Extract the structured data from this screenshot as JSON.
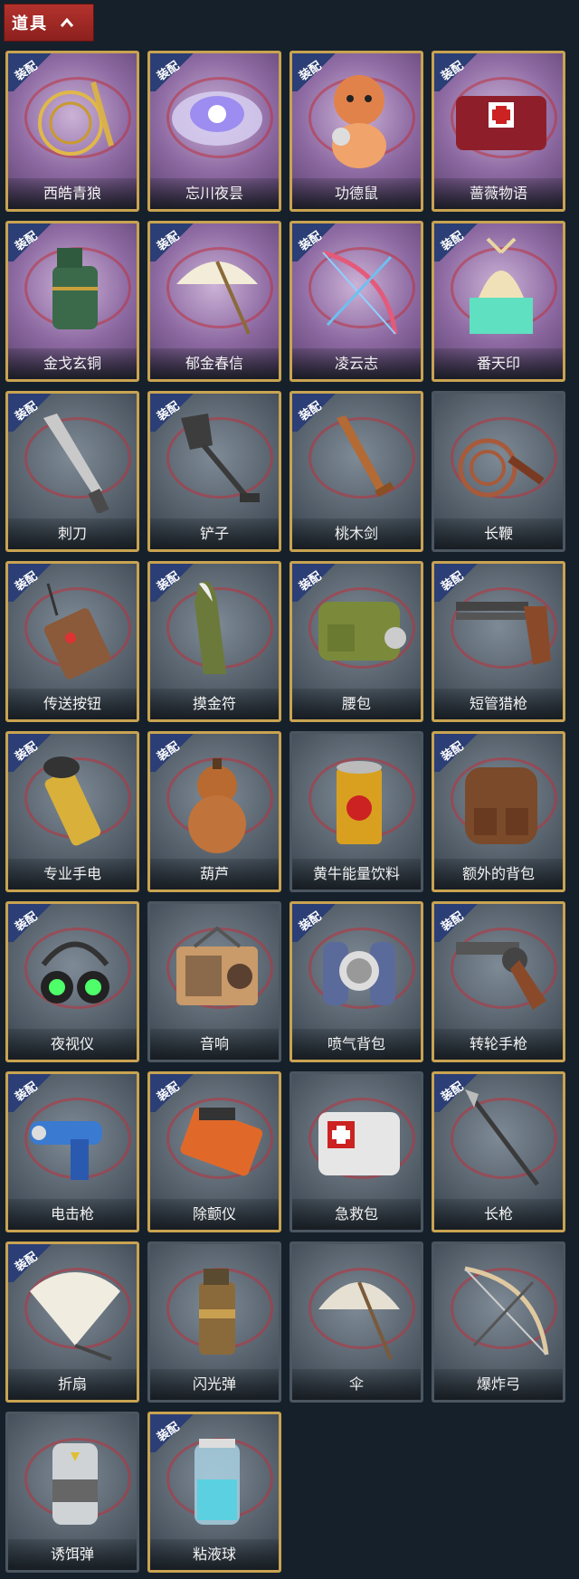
{
  "header": {
    "title": "道具",
    "toggle_icon": "chevron-up-icon"
  },
  "badge_text": "装配",
  "items": [
    {
      "label": "西皓青狼",
      "equipped": true,
      "theme": "purple",
      "icon": "golden-whip-icon"
    },
    {
      "label": "忘川夜昙",
      "equipped": true,
      "theme": "purple",
      "icon": "lotus-icon"
    },
    {
      "label": "功德鼠",
      "equipped": true,
      "theme": "purple",
      "icon": "hamster-icon"
    },
    {
      "label": "蔷薇物语",
      "equipped": true,
      "theme": "purple",
      "icon": "medkit-red-icon"
    },
    {
      "label": "金戈玄铜",
      "equipped": true,
      "theme": "purple",
      "icon": "bronze-grenade-icon"
    },
    {
      "label": "郁金春信",
      "equipped": true,
      "theme": "purple",
      "icon": "parasol-icon"
    },
    {
      "label": "凌云志",
      "equipped": true,
      "theme": "purple",
      "icon": "bow-icon"
    },
    {
      "label": "番天印",
      "equipped": true,
      "theme": "purple",
      "icon": "phoenix-seal-icon"
    },
    {
      "label": "刺刀",
      "equipped": true,
      "theme": "gray",
      "icon": "knife-icon"
    },
    {
      "label": "铲子",
      "equipped": true,
      "theme": "gray",
      "icon": "shovel-icon"
    },
    {
      "label": "桃木剑",
      "equipped": true,
      "theme": "gray",
      "icon": "wooden-sword-icon"
    },
    {
      "label": "长鞭",
      "equipped": false,
      "theme": "gray",
      "icon": "whip-icon"
    },
    {
      "label": "传送按钮",
      "equipped": true,
      "theme": "gray",
      "icon": "remote-icon"
    },
    {
      "label": "摸金符",
      "equipped": true,
      "theme": "gray",
      "icon": "amulet-icon"
    },
    {
      "label": "腰包",
      "equipped": true,
      "theme": "gray",
      "icon": "bag-icon"
    },
    {
      "label": "短管猎枪",
      "equipped": true,
      "theme": "gray",
      "icon": "shotgun-icon"
    },
    {
      "label": "专业手电",
      "equipped": true,
      "theme": "gray",
      "icon": "flashlight-icon"
    },
    {
      "label": "葫芦",
      "equipped": true,
      "theme": "gray",
      "icon": "gourd-icon"
    },
    {
      "label": "黄牛能量饮料",
      "equipped": false,
      "theme": "gray",
      "icon": "can-icon"
    },
    {
      "label": "额外的背包",
      "equipped": true,
      "theme": "gray",
      "icon": "backpack-icon"
    },
    {
      "label": "夜视仪",
      "equipped": true,
      "theme": "gray",
      "icon": "goggles-icon"
    },
    {
      "label": "音响",
      "equipped": false,
      "theme": "gray",
      "icon": "radio-icon"
    },
    {
      "label": "喷气背包",
      "equipped": true,
      "theme": "gray",
      "icon": "jetpack-icon"
    },
    {
      "label": "转轮手枪",
      "equipped": true,
      "theme": "gray",
      "icon": "revolver-icon"
    },
    {
      "label": "电击枪",
      "equipped": true,
      "theme": "gray",
      "icon": "taser-icon"
    },
    {
      "label": "除颤仪",
      "equipped": true,
      "theme": "gray",
      "icon": "defibrillator-icon"
    },
    {
      "label": "急救包",
      "equipped": false,
      "theme": "gray",
      "icon": "first-aid-icon"
    },
    {
      "label": "长枪",
      "equipped": true,
      "theme": "gray",
      "icon": "spear-icon"
    },
    {
      "label": "折扇",
      "equipped": true,
      "theme": "gray",
      "icon": "fan-icon"
    },
    {
      "label": "闪光弹",
      "equipped": false,
      "theme": "gray",
      "icon": "flashbang-icon"
    },
    {
      "label": "伞",
      "equipped": false,
      "theme": "gray",
      "icon": "umbrella-icon"
    },
    {
      "label": "爆炸弓",
      "equipped": false,
      "theme": "gray",
      "icon": "explosive-bow-icon"
    },
    {
      "label": "诱饵弹",
      "equipped": false,
      "theme": "gray",
      "icon": "decoy-icon"
    },
    {
      "label": "粘液球",
      "equipped": true,
      "theme": "gray",
      "icon": "slime-icon"
    }
  ]
}
